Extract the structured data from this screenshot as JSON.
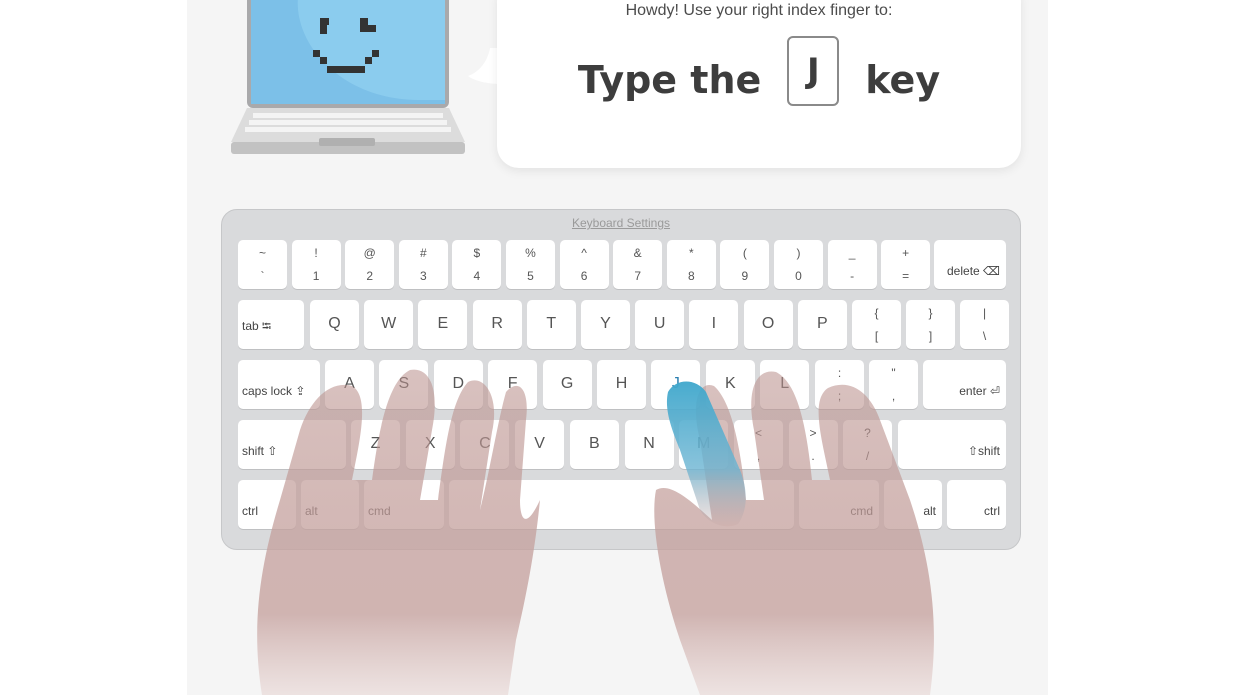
{
  "bubble": {
    "instruction": "Howdy! Use your right index finger to:",
    "prompt_before": "Type the",
    "target_key": "J",
    "prompt_after": "key"
  },
  "keyboard": {
    "settings_link": "Keyboard Settings",
    "row1": [
      {
        "top": "~",
        "bot": "`"
      },
      {
        "top": "!",
        "bot": "1"
      },
      {
        "top": "@",
        "bot": "2"
      },
      {
        "top": "#",
        "bot": "3"
      },
      {
        "top": "$",
        "bot": "4"
      },
      {
        "top": "%",
        "bot": "5"
      },
      {
        "top": "^",
        "bot": "6"
      },
      {
        "top": "&",
        "bot": "7"
      },
      {
        "top": "*",
        "bot": "8"
      },
      {
        "top": "(",
        "bot": "9"
      },
      {
        "top": ")",
        "bot": "0"
      },
      {
        "top": "_",
        "bot": "-"
      },
      {
        "top": "+",
        "bot": "="
      }
    ],
    "delete_label": "delete ⌫",
    "tab_label": "tab ⭾",
    "row2": [
      "Q",
      "W",
      "E",
      "R",
      "T",
      "Y",
      "U",
      "I",
      "O",
      "P"
    ],
    "row2_symbols": [
      {
        "top": "{",
        "bot": "["
      },
      {
        "top": "}",
        "bot": "]"
      },
      {
        "top": "|",
        "bot": "\\"
      }
    ],
    "caps_label": "caps lock ⇪",
    "row3": [
      "A",
      "S",
      "D",
      "F",
      "G",
      "H",
      "J",
      "K",
      "L"
    ],
    "row3_symbols": [
      {
        "top": ":",
        "bot": ";"
      },
      {
        "top": "\"",
        "bot": ","
      }
    ],
    "enter_label": "enter ⏎",
    "shift_left_label": "shift ⇧",
    "row4": [
      "Z",
      "X",
      "C",
      "V",
      "B",
      "N",
      "M"
    ],
    "row4_symbols": [
      {
        "top": "<",
        "bot": ","
      },
      {
        "top": ">",
        "bot": "."
      },
      {
        "top": "?",
        "bot": "/"
      }
    ],
    "shift_right_label": "⇧shift",
    "bottom": {
      "ctrl_left": "ctrl",
      "alt_left": "alt",
      "cmd_left": "cmd",
      "cmd_right": "cmd",
      "alt_right": "alt",
      "ctrl_right": "ctrl"
    },
    "highlighted_key": "J"
  },
  "colors": {
    "screen_blue": "#7cc0e8",
    "finger_highlight": "#3ea7cc",
    "hand_tint": "#c9a8a5",
    "keyboard_bg": "#d9dadc"
  }
}
